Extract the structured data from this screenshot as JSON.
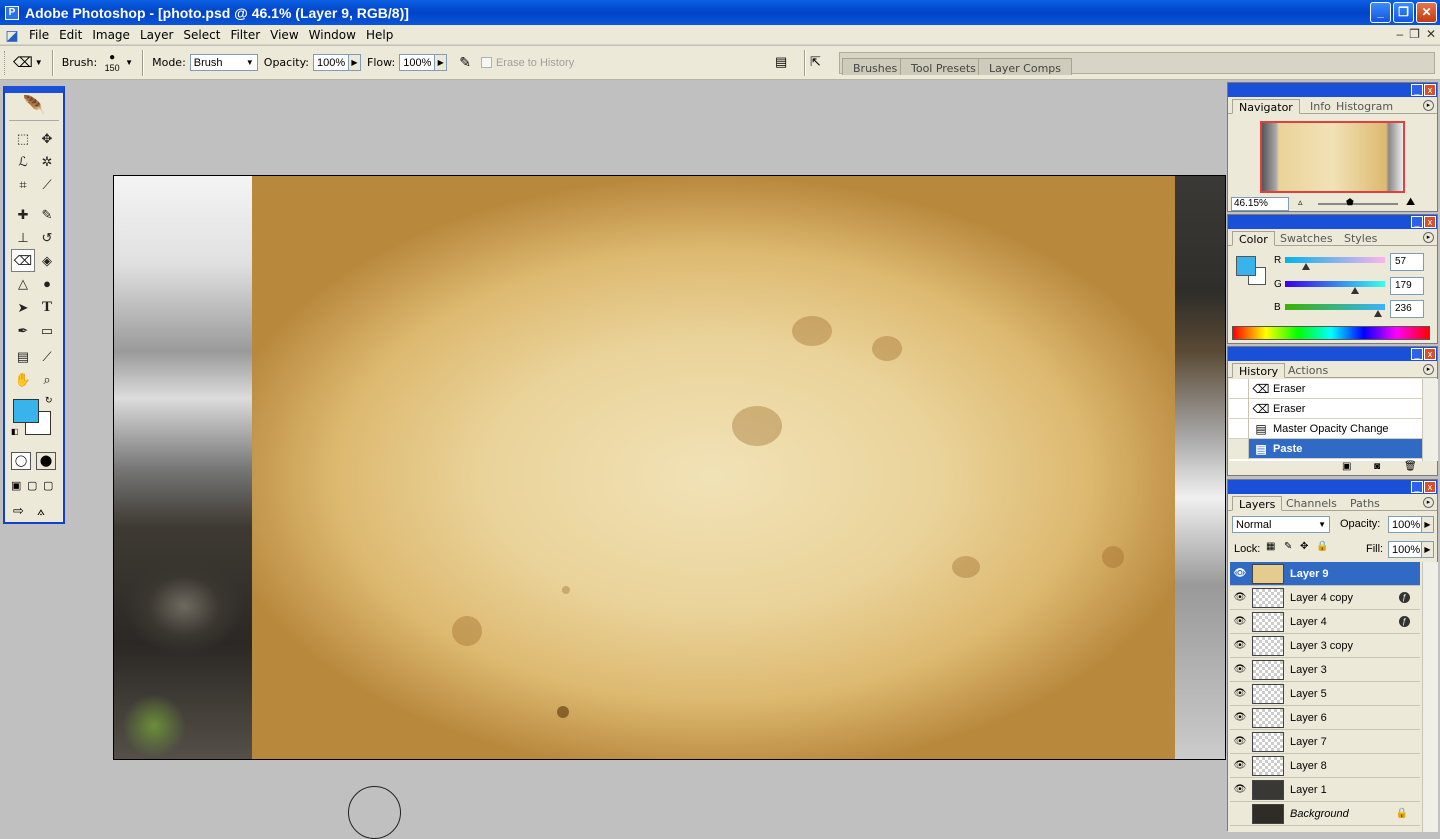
{
  "window": {
    "title": "Adobe Photoshop - [photo.psd @ 46.1% (Layer 9, RGB/8)]",
    "minimize": "_",
    "restore": "❐",
    "close": "✕"
  },
  "menu": [
    "File",
    "Edit",
    "Image",
    "Layer",
    "Select",
    "Filter",
    "View",
    "Window",
    "Help"
  ],
  "options": {
    "brush_label": "Brush:",
    "brush_size": "150",
    "mode_label": "Mode:",
    "mode_value": "Brush",
    "opacity_label": "Opacity:",
    "opacity_value": "100%",
    "flow_label": "Flow:",
    "flow_value": "100%",
    "erase_to_history": "Erase to History"
  },
  "palette_well": {
    "tabs": [
      "Brushes",
      "Tool Presets",
      "Layer Comps"
    ]
  },
  "navigator": {
    "tabs": [
      "Navigator",
      "Info",
      "Histogram"
    ],
    "zoom": "46.15%"
  },
  "color": {
    "tabs": [
      "Color",
      "Swatches",
      "Styles"
    ],
    "r_label": "R",
    "r_value": "57",
    "g_label": "G",
    "g_value": "179",
    "b_label": "B",
    "b_value": "236",
    "foreground": "#39b3ec"
  },
  "history": {
    "tabs": [
      "History",
      "Actions"
    ],
    "items": [
      {
        "label": "Eraser"
      },
      {
        "label": "Eraser"
      },
      {
        "label": "Master Opacity Change"
      },
      {
        "label": "Paste"
      }
    ]
  },
  "layers": {
    "tabs": [
      "Layers",
      "Channels",
      "Paths"
    ],
    "blend_mode": "Normal",
    "opacity_label": "Opacity:",
    "opacity_value": "100%",
    "lock_label": "Lock:",
    "fill_label": "Fill:",
    "fill_value": "100%",
    "items": [
      {
        "label": "Layer 9"
      },
      {
        "label": "Layer 4 copy"
      },
      {
        "label": "Layer 4"
      },
      {
        "label": "Layer 3 copy"
      },
      {
        "label": "Layer 3"
      },
      {
        "label": "Layer 5"
      },
      {
        "label": "Layer 6"
      },
      {
        "label": "Layer 7"
      },
      {
        "label": "Layer 8"
      },
      {
        "label": "Layer 1"
      },
      {
        "label": "Background"
      }
    ]
  }
}
